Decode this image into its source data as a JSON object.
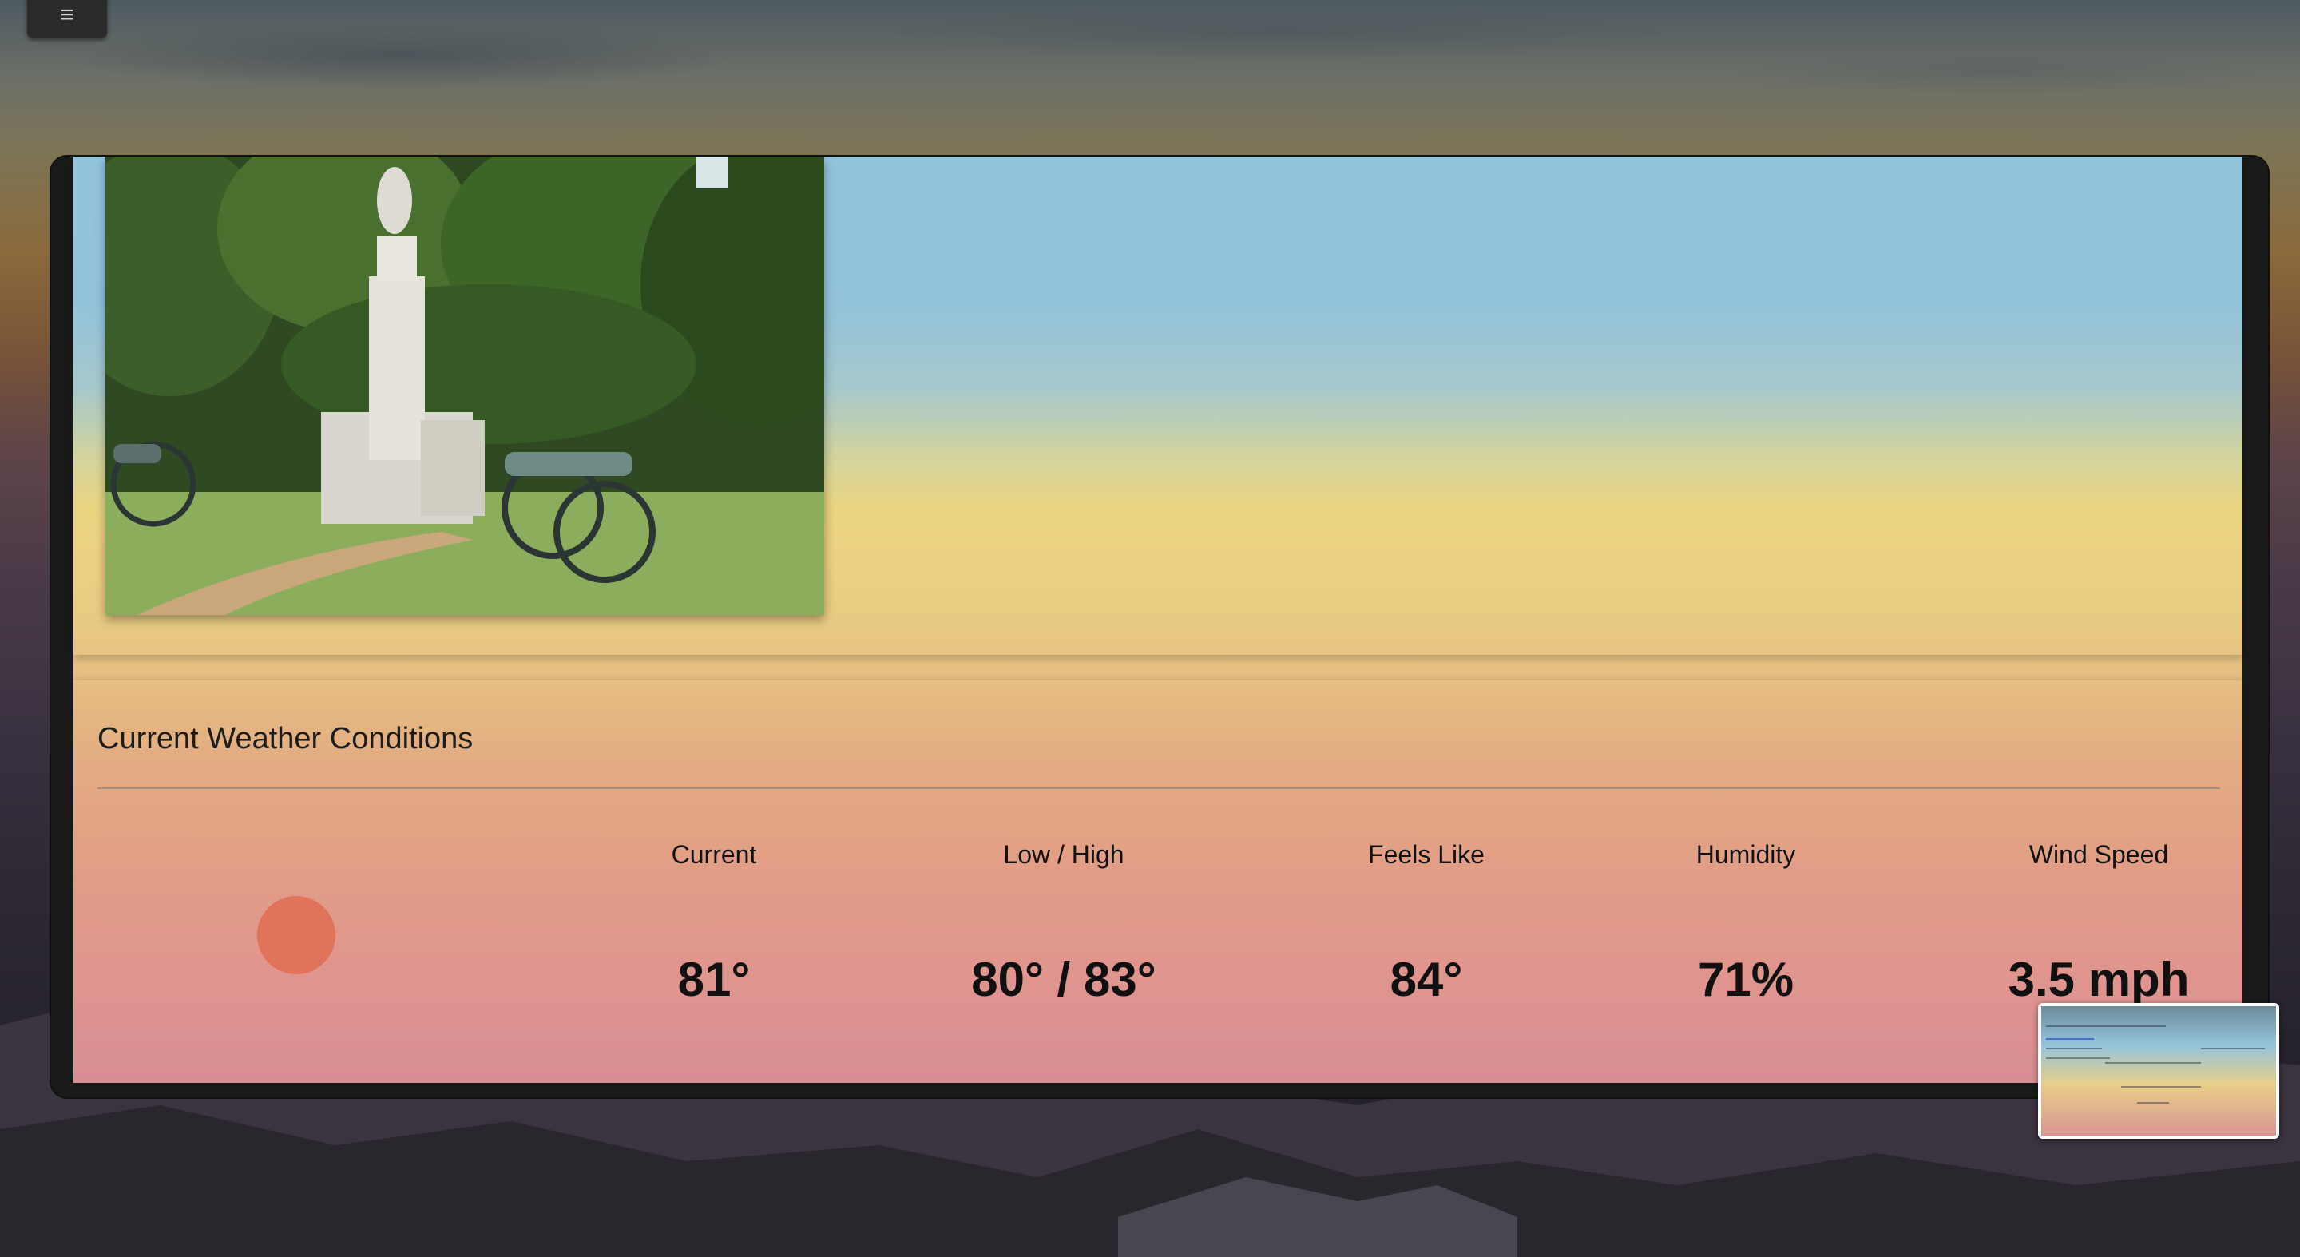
{
  "menu": {
    "icon": "hamburger-menu-icon",
    "glyph": "≡"
  },
  "photo": {
    "subject": "battlefield-monument-with-cannons"
  },
  "weather": {
    "title": "Current Weather Conditions",
    "icon": "sun-icon",
    "stats": [
      {
        "label": "Current",
        "value": "81°"
      },
      {
        "label": "Low / High",
        "value": "80° / 83°"
      },
      {
        "label": "Feels Like",
        "value": "84°"
      },
      {
        "label": "Humidity",
        "value": "71%"
      },
      {
        "label": "Wind Speed",
        "value": "3.5 mph"
      }
    ]
  },
  "colors": {
    "sun": "#e0735a",
    "sky": "#93c4dc",
    "panel_yellow": "#ecd283",
    "panel_pink": "#df9490"
  }
}
